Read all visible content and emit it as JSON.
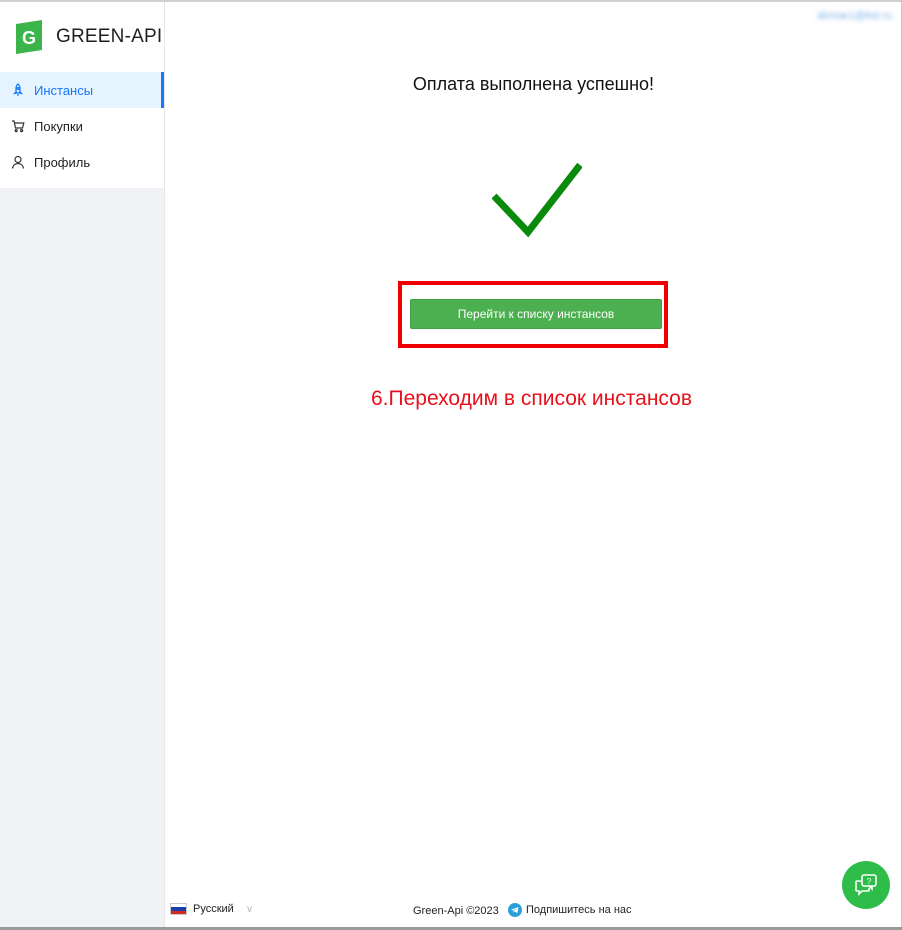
{
  "brand": {
    "name": "GREEN-API",
    "logo_letter": "G",
    "color": "#3bb44a"
  },
  "header": {
    "user_email": "dirmar1@list.ru"
  },
  "sidebar": {
    "items": [
      {
        "label": "Инстансы",
        "icon": "rocket-icon",
        "active": true
      },
      {
        "label": "Покупки",
        "icon": "cart-icon",
        "active": false
      },
      {
        "label": "Профиль",
        "icon": "user-icon",
        "active": false
      }
    ]
  },
  "main": {
    "title": "Оплата выполнена успешно!",
    "check_color": "#0a8a0a",
    "button_label": "Перейти к списку инстансов",
    "button_color": "#4caf50",
    "annotation": "6.Переходим в список инстансов",
    "annotation_color": "#e8101a",
    "highlight_color": "#ee0000"
  },
  "footer": {
    "language": "Русский",
    "copyright": "Green-Api ©2023",
    "subscribe": "Подпишитесь на нас"
  },
  "chat": {
    "icon": "chat-support-icon",
    "color": "#2ebd49"
  }
}
